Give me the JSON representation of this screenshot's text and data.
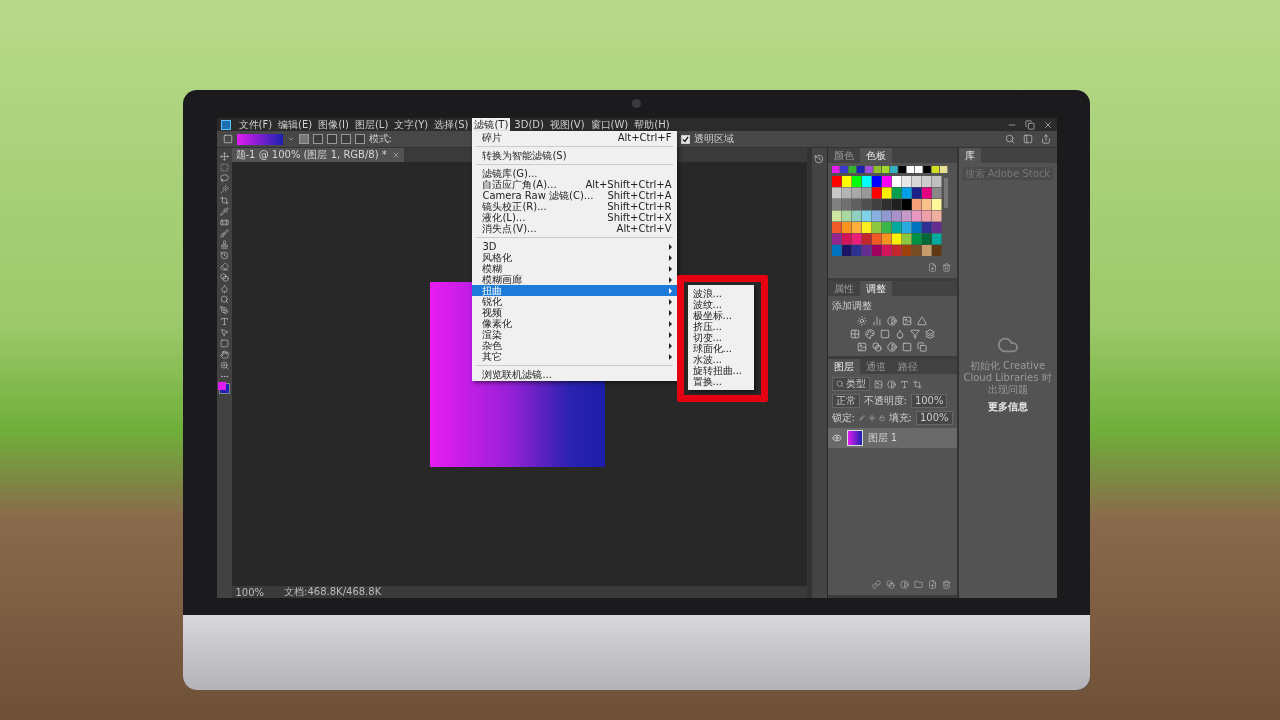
{
  "menu_bar": {
    "items": [
      {
        "label": "文件(F)",
        "selected": false
      },
      {
        "label": "编辑(E)",
        "selected": false
      },
      {
        "label": "图像(I)",
        "selected": false
      },
      {
        "label": "图层(L)",
        "selected": false
      },
      {
        "label": "文字(Y)",
        "selected": false
      },
      {
        "label": "选择(S)",
        "selected": false
      },
      {
        "label": "滤镜(T)",
        "selected": true
      },
      {
        "label": "3D(D)",
        "selected": false
      },
      {
        "label": "视图(V)",
        "selected": false
      },
      {
        "label": "窗口(W)",
        "selected": false
      },
      {
        "label": "帮助(H)",
        "selected": false
      }
    ]
  },
  "options_bar": {
    "mode_label": "模式:",
    "transparency": {
      "label": "透明区域",
      "checked": true
    }
  },
  "document_tab": {
    "title": "题-1 @ 100% (图层 1, RGB/8) *"
  },
  "filter_menu": {
    "sections": [
      [
        {
          "label": "碎片",
          "shortcut": "Alt+Ctrl+F",
          "kind": "command",
          "selected": false
        }
      ],
      [
        {
          "label": "转换为智能滤镜(S)",
          "kind": "command",
          "selected": false
        }
      ],
      [
        {
          "label": "滤镜库(G)...",
          "kind": "command",
          "selected": false
        },
        {
          "label": "自适应广角(A)...",
          "shortcut": "Alt+Shift+Ctrl+A",
          "kind": "command",
          "selected": false
        },
        {
          "label": "Camera Raw 滤镜(C)...",
          "shortcut": "Shift+Ctrl+A",
          "kind": "command",
          "selected": false
        },
        {
          "label": "镜头校正(R)...",
          "shortcut": "Shift+Ctrl+R",
          "kind": "command",
          "selected": false
        },
        {
          "label": "液化(L)...",
          "shortcut": "Shift+Ctrl+X",
          "kind": "command",
          "selected": false
        },
        {
          "label": "消失点(V)...",
          "shortcut": "Alt+Ctrl+V",
          "kind": "command",
          "selected": false
        }
      ],
      [
        {
          "label": "3D",
          "kind": "submenu",
          "selected": false
        },
        {
          "label": "风格化",
          "kind": "submenu",
          "selected": false
        },
        {
          "label": "模糊",
          "kind": "submenu",
          "selected": false
        },
        {
          "label": "模糊画廊",
          "kind": "submenu",
          "selected": false
        },
        {
          "label": "扭曲",
          "kind": "submenu",
          "selected": true
        },
        {
          "label": "锐化",
          "kind": "submenu",
          "selected": false
        },
        {
          "label": "视频",
          "kind": "submenu",
          "selected": false
        },
        {
          "label": "像素化",
          "kind": "submenu",
          "selected": false
        },
        {
          "label": "渲染",
          "kind": "submenu",
          "selected": false
        },
        {
          "label": "杂色",
          "kind": "submenu",
          "selected": false
        },
        {
          "label": "其它",
          "kind": "submenu",
          "selected": false
        }
      ],
      [
        {
          "label": "浏览联机滤镜...",
          "kind": "command",
          "selected": false
        }
      ]
    ]
  },
  "distort_submenu": {
    "items": [
      "波浪...",
      "波纹...",
      "极坐标...",
      "挤压...",
      "切变...",
      "球面化...",
      "水波...",
      "旋转扭曲...",
      "置换..."
    ]
  },
  "status_bar": {
    "zoom": "100%",
    "doc_info": "文档:468.8K/468.8K"
  },
  "swatches_panel": {
    "tabs": [
      {
        "label": "颜色",
        "selected": false
      },
      {
        "label": "色板",
        "selected": true
      }
    ]
  },
  "adjustments_panel": {
    "tabs": [
      {
        "label": "属性",
        "selected": false
      },
      {
        "label": "调整",
        "selected": true
      }
    ],
    "heading": "添加调整"
  },
  "layers_panel": {
    "tabs": [
      {
        "label": "图层",
        "selected": true
      },
      {
        "label": "通道",
        "selected": false
      },
      {
        "label": "路径",
        "selected": false
      }
    ],
    "filter": "类型",
    "blend_mode": "正常",
    "opacity_label": "不透明度:",
    "opacity": "100%",
    "lock_label": "锁定:",
    "fill_label": "填充:",
    "fill": "100%",
    "layers": [
      {
        "name": "图层 1",
        "visible": true,
        "selected": true
      }
    ]
  },
  "library_panel": {
    "tabs": [
      {
        "label": "库",
        "selected": true
      }
    ],
    "search": {
      "placeholder": "搜索 Adobe Stock"
    },
    "message": "初始化 Creative Cloud Libraries 时出现问题",
    "link": "更多信息"
  }
}
